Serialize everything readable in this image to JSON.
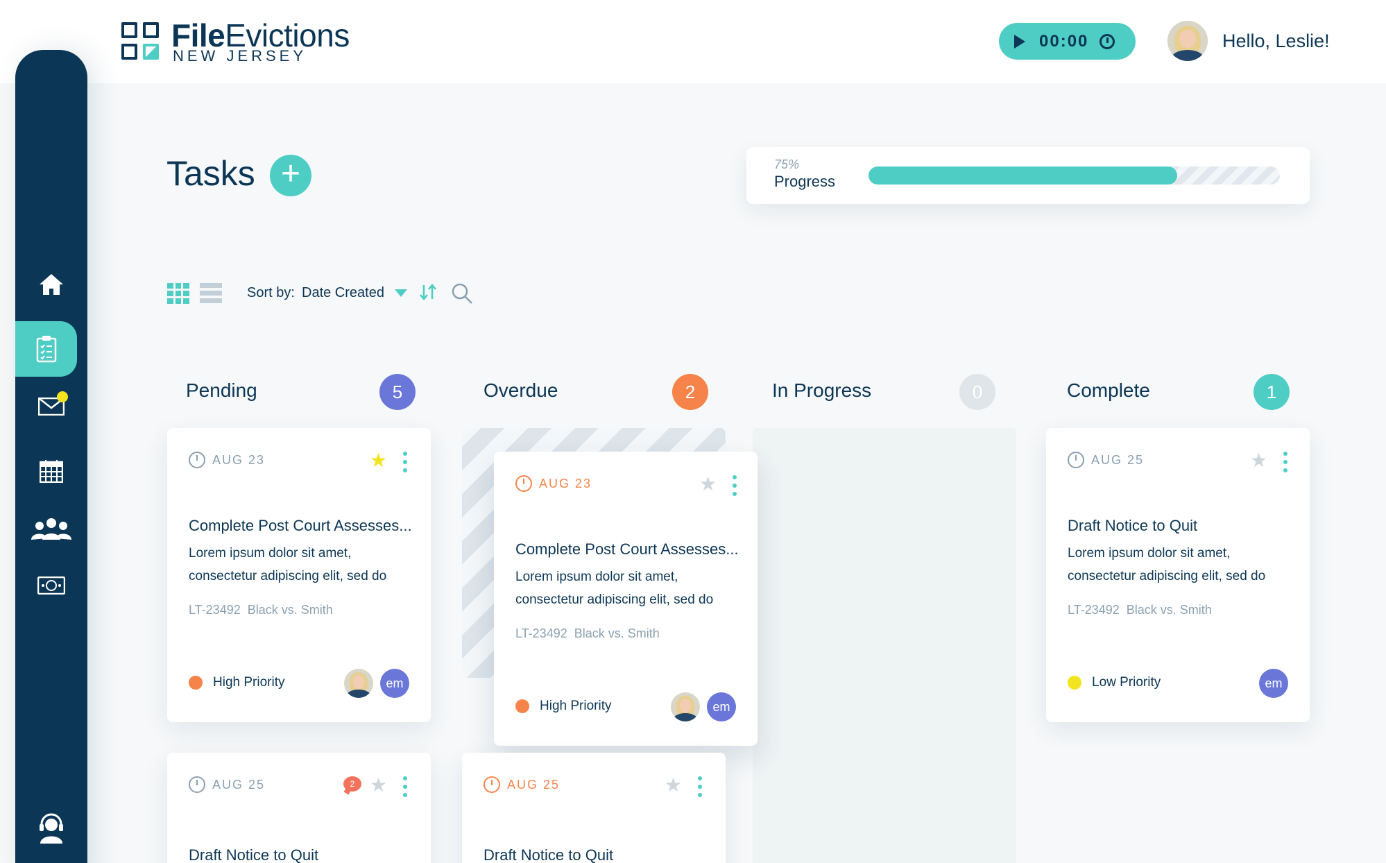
{
  "header": {
    "logo_bold": "File",
    "logo_rest": "Evictions",
    "logo_sub": "NEW JERSEY",
    "timer": "00:00",
    "greeting": "Hello, Leslie!"
  },
  "sidebar": {
    "items": [
      {
        "icon": "home-icon"
      },
      {
        "icon": "clipboard-icon",
        "active": true
      },
      {
        "icon": "mail-icon",
        "notification": true
      },
      {
        "icon": "calendar-icon"
      },
      {
        "icon": "users-icon"
      },
      {
        "icon": "money-icon"
      },
      {
        "icon": "support-headset-icon"
      }
    ]
  },
  "main": {
    "title": "Tasks",
    "add_label": "+",
    "progress": {
      "percent_label": "75%",
      "label": "Progress",
      "value": 0.75
    },
    "toolbar": {
      "sort_label": "Sort by:",
      "sort_value": "Date Created"
    }
  },
  "columns": [
    {
      "title": "Pending",
      "count": "5",
      "color": "#6a76d8"
    },
    {
      "title": "Overdue",
      "count": "2",
      "color": "#f6844a"
    },
    {
      "title": "In Progress",
      "count": "0",
      "color": "#dfe5e9"
    },
    {
      "title": "Complete",
      "count": "1",
      "color": "#4ecdc4"
    }
  ],
  "cards": {
    "pending_1": {
      "date": "AUG 23",
      "title": "Complete Post Court Assesses...",
      "desc": "Lorem ipsum dolor sit amet, consectetur adipiscing elit, sed do",
      "case_id": "LT-23492",
      "case_name": "Black vs. Smith",
      "priority": "High Priority",
      "priority_color": "#f6844a",
      "starred": true,
      "assignee_initials": "em"
    },
    "overdue_1": {
      "date": "AUG 23",
      "title": "Complete Post Court Assesses...",
      "desc": "Lorem ipsum dolor sit amet, consectetur adipiscing elit, sed do",
      "case_id": "LT-23492",
      "case_name": "Black vs. Smith",
      "priority": "High Priority",
      "priority_color": "#f6844a",
      "starred": false,
      "assignee_initials": "em"
    },
    "complete_1": {
      "date": "AUG 25",
      "title": "Draft Notice to Quit",
      "desc": "Lorem ipsum dolor sit amet, consectetur adipiscing elit, sed do",
      "case_id": "LT-23492",
      "case_name": "Black vs. Smith",
      "priority": "Low Priority",
      "priority_color": "#f2e51f",
      "starred": false,
      "assignee_initials": "em"
    },
    "pending_2": {
      "date": "AUG 25",
      "title": "Draft Notice to Quit",
      "comments": "2",
      "starred": false
    },
    "overdue_2": {
      "date": "AUG 25",
      "title": "Draft Notice to Quit",
      "starred": false
    }
  },
  "colors": {
    "navy": "#0c3655",
    "teal": "#4ecdc4",
    "orange": "#f6844a",
    "indigo": "#6a76d8",
    "yellow": "#f2e51f"
  }
}
